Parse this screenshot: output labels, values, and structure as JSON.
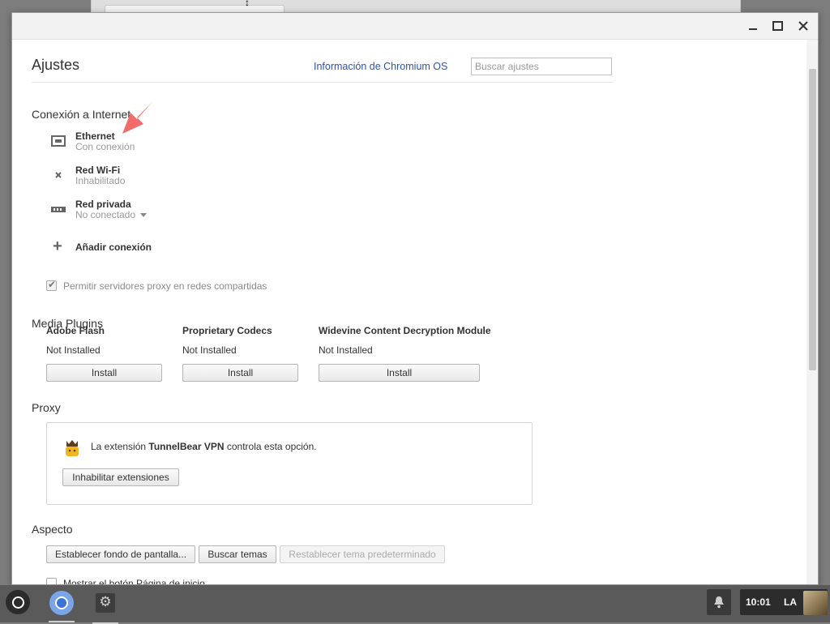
{
  "window": {
    "title": ""
  },
  "header": {
    "title": "Ajustes",
    "about_link": "Información de Chromium OS",
    "search_placeholder": "Buscar ajustes"
  },
  "internet": {
    "title": "Conexión a Internet",
    "networks": [
      {
        "name": "Ethernet",
        "status": "Con conexión",
        "icon": "ethernet-icon"
      },
      {
        "name": "Red Wi-Fi",
        "status": "Inhabilitado",
        "icon": "wifi-disabled-icon"
      },
      {
        "name": "Red privada",
        "status": "No conectado",
        "icon": "vpn-icon"
      }
    ],
    "add_connection": "Añadir conexión",
    "proxy_shared_label": "Permitir servidores proxy en redes compartidas",
    "proxy_shared_checked": true
  },
  "media": {
    "title": "Media Plugins",
    "plugins": [
      {
        "name": "Adobe Flash",
        "status": "Not Installed",
        "button": "Install"
      },
      {
        "name": "Proprietary Codecs",
        "status": "Not Installed",
        "button": "Install"
      },
      {
        "name": "Widevine Content Decryption Module",
        "status": "Not Installed",
        "button": "Install"
      }
    ]
  },
  "proxy": {
    "title": "Proxy",
    "text_before": "La extensión ",
    "extension_name": "TunnelBear VPN",
    "text_after": " controla esta opción.",
    "disable_button": "Inhabilitar extensiones"
  },
  "appearance": {
    "title": "Aspecto",
    "wallpaper_button": "Establecer fondo de pantalla...",
    "themes_button": "Buscar temas",
    "reset_theme_button": "Restablecer tema predeterminado",
    "home_button_label": "Mostrar el botón Página de inicio"
  },
  "shelf": {
    "clock": "10:01",
    "ime": "LA"
  },
  "colors": {
    "link": "#2b55b0",
    "annotation_arrow": "#f26b6b",
    "shelf": "#5a5a5a"
  }
}
